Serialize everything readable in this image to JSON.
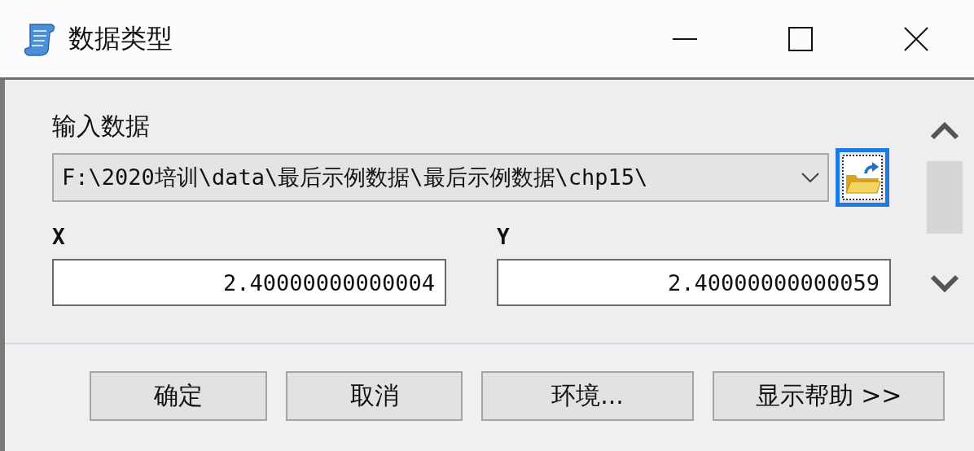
{
  "window": {
    "title": "数据类型"
  },
  "input_data": {
    "label": "输入数据",
    "value": "F:\\2020培训\\data\\最后示例数据\\最后示例数据\\chp15\\"
  },
  "fields": [
    {
      "label": "X",
      "value": "2.40000000000004"
    },
    {
      "label": "Y",
      "value": "2.40000000000059"
    }
  ],
  "buttons": [
    "确定",
    "取消",
    "环境...",
    "显示帮助 >>"
  ]
}
